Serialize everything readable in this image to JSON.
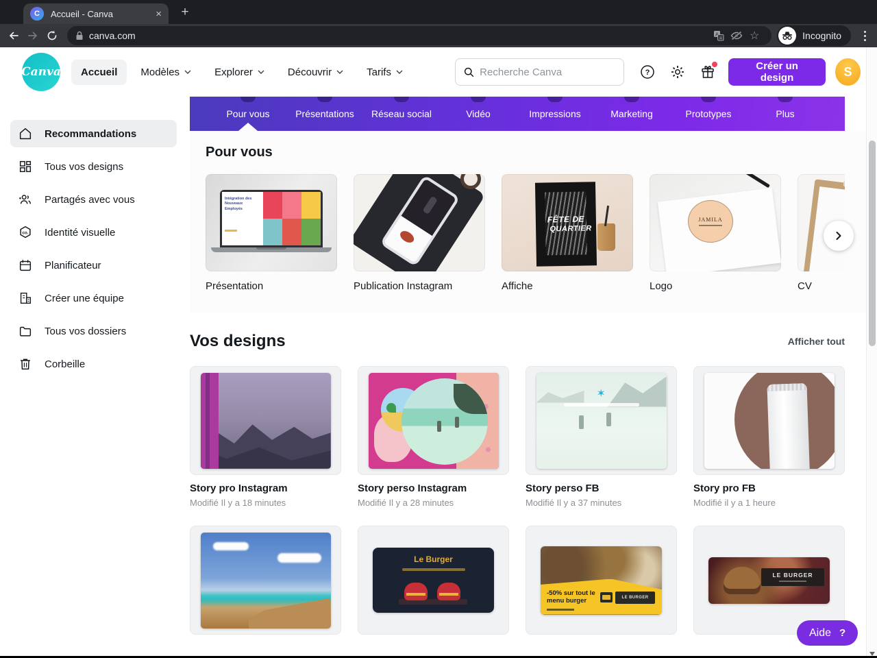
{
  "browser": {
    "tab_title": "Accueil - Canva",
    "close_tab_glyph": "×",
    "new_tab_glyph": "+",
    "favicon_letter": "C",
    "url": "canva.com",
    "star_glyph": "☆",
    "incognito_label": "Incognito"
  },
  "header": {
    "logo_text": "Canva",
    "nav": [
      {
        "label": "Accueil"
      },
      {
        "label": "Modèles"
      },
      {
        "label": "Explorer"
      },
      {
        "label": "Découvrir"
      },
      {
        "label": "Tarifs"
      }
    ],
    "search_placeholder": "Recherche Canva",
    "create_button_label": "Créer un design",
    "avatar_initial": "S"
  },
  "category_bar": {
    "items": [
      "Pour vous",
      "Présentations",
      "Réseau social",
      "Vidéo",
      "Impressions",
      "Marketing",
      "Prototypes",
      "Plus"
    ],
    "active": "Pour vous"
  },
  "sidebar": {
    "items": [
      {
        "label": "Recommandations"
      },
      {
        "label": "Tous vos designs"
      },
      {
        "label": "Partagés avec vous"
      },
      {
        "label": "Identité visuelle"
      },
      {
        "label": "Planificateur"
      },
      {
        "label": "Créer une équipe"
      },
      {
        "label": "Tous vos dossiers"
      },
      {
        "label": "Corbeille"
      }
    ]
  },
  "for_you": {
    "title": "Pour vous",
    "templates": [
      {
        "label": "Présentation",
        "slide_title": "Intégration des Nouveaux Employés"
      },
      {
        "label": "Publication Instagram"
      },
      {
        "label": "Affiche",
        "poster_line1": "FÊTE DE",
        "poster_line2": "QUARTIER"
      },
      {
        "label": "Logo",
        "sticker_text": "JAMILA"
      },
      {
        "label": "CV"
      }
    ]
  },
  "your_designs": {
    "title": "Vos designs",
    "show_all_label": "Afficher tout",
    "designs": [
      {
        "title": "Story pro Instagram",
        "modified": "Modifié Il y a 18 minutes"
      },
      {
        "title": "Story perso Instagram",
        "modified": "Modifié Il y a 28 minutes"
      },
      {
        "title": "Story perso FB",
        "modified": "Modifié Il y a 37 minutes"
      },
      {
        "title": "Story pro FB",
        "modified": "Modifié il y a 1 heure"
      }
    ],
    "more_designs": {
      "burger_card_title": "Le Burger",
      "promo_text": "-50% sur tout le menu burger",
      "badge_text": "LE BURGER",
      "star_glyph": "✶"
    }
  },
  "help_button": {
    "label": "Aide",
    "icon": "?"
  },
  "colors": {
    "accent_purple": "#7d2ae8",
    "canva_teal": "#14c0c8",
    "avatar_orange": "#f6a81c",
    "magenta": "#d23b8e"
  }
}
